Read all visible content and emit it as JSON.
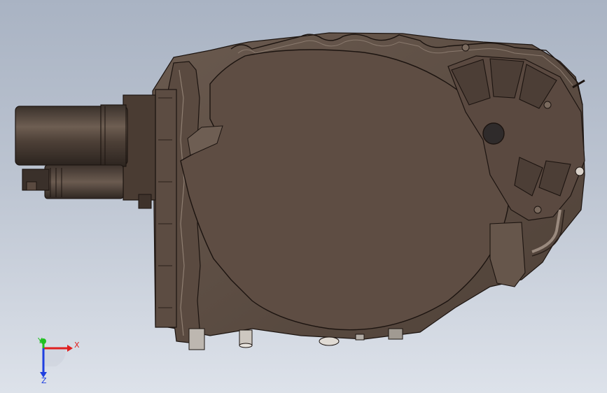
{
  "viewport": {
    "background_top": "#a9b3c3",
    "background_bottom": "#dde2ea",
    "model_color": "#5e4d43",
    "model_edge_color": "#1c1410"
  },
  "triad": {
    "x_label": "X",
    "y_label": "Y",
    "z_label": "Z",
    "x_color": "#e02020",
    "y_color": "#20c020",
    "z_color": "#2040e0"
  }
}
